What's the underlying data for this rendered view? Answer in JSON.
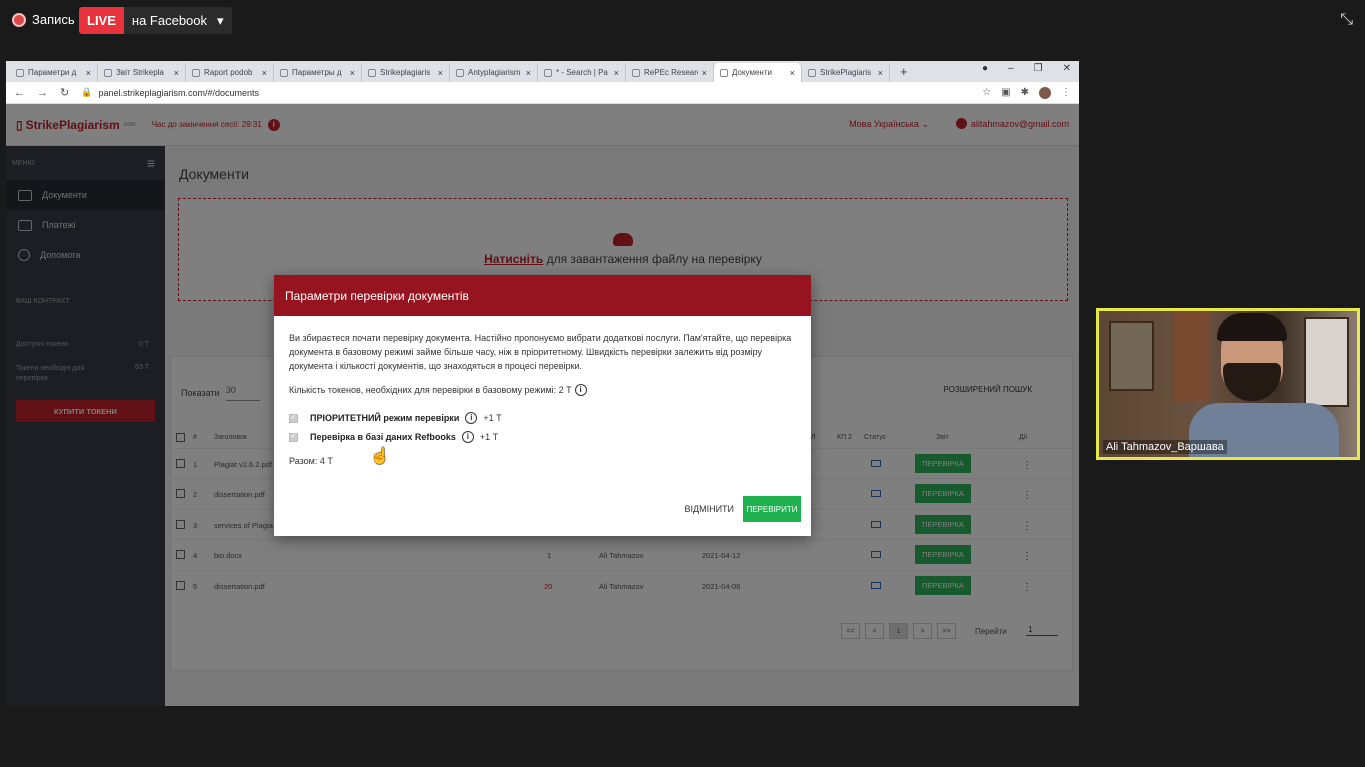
{
  "zoom": {
    "recording_label": "Запись",
    "live_label": "LIVE",
    "live_target": "на Facebook"
  },
  "browser": {
    "tabs": [
      {
        "title": "Параметри д"
      },
      {
        "title": "Звіт Strikepla"
      },
      {
        "title": "Raport podob"
      },
      {
        "title": "Параметры д"
      },
      {
        "title": "Strikeplagiaris"
      },
      {
        "title": "Antyplagiarism"
      },
      {
        "title": "* - Search | Pa"
      },
      {
        "title": "RePEc Researc"
      },
      {
        "title": "Документи",
        "active": true
      },
      {
        "title": "StrikePlagiaris"
      }
    ],
    "url": "panel.strikeplagiarism.com/#/documents"
  },
  "app": {
    "logo": "StrikePlagiarism",
    "logo_suffix": ".com",
    "session_label": "Час до закінчення сесії: 29:31",
    "language": "Мова Українська",
    "user_email": "alitahmazov@gmail.com",
    "sidebar": {
      "menu_label": "МЕНЮ",
      "items": [
        {
          "label": "Документи",
          "icon": "folder-icon"
        },
        {
          "label": "Платежі",
          "icon": "card-icon"
        },
        {
          "label": "Допомога",
          "icon": "help-icon"
        }
      ],
      "contract_label": "ВАШ КОНТРАКТ",
      "available_label": "Доступні токени",
      "available_value": "0 Т",
      "needed_label": "Токени необхідні для перевірки",
      "needed_value": "63 Т",
      "buy_label": "КУПИТИ ТОКЕНИ"
    },
    "main": {
      "title": "Документи",
      "upload_link": "Натисніть",
      "upload_rest": " для завантаження файлу на перевірку",
      "show_label": "Показати",
      "show_value": "30",
      "advanced_search": "РОЗШИРЕНИЙ ПОШУК",
      "columns": {
        "num": "#",
        "title": "Заголовок",
        "kp1": "Л",
        "kp2": "КП 2",
        "status": "Статус",
        "report": "Звіт",
        "actions": "Дії"
      },
      "rows": [
        {
          "num": "1",
          "title": "Plagiat v2.6.2.pdf",
          "kp": "",
          "author": "",
          "date": "",
          "action": "ПЕРЕВІРКА"
        },
        {
          "num": "2",
          "title": "dissertation.pdf",
          "kp": "",
          "author": "",
          "date": "",
          "action": "ПЕРЕВІРКА"
        },
        {
          "num": "3",
          "title": "services of Plagia",
          "kp": "",
          "author": "",
          "date": "",
          "action": "ПЕРЕВІРКА"
        },
        {
          "num": "4",
          "title": "bio.docx",
          "kp": "1",
          "author": "Ali Tahmazov",
          "date": "2021-04-12",
          "action": "ПЕРЕВІРКА"
        },
        {
          "num": "5",
          "title": "dissertation.pdf",
          "kp": "20",
          "author": "Ali Tahmazov",
          "date": "2021-04-06",
          "action": "ПЕРЕВІРКА"
        }
      ],
      "pager": [
        "<<",
        "<",
        "1",
        ">",
        ">>"
      ],
      "goto_label": "Перейти",
      "goto_value": "1"
    }
  },
  "modal": {
    "title": "Параметри перевірки документів",
    "intro": "Ви збираєтеся почати перевірку документа. Настійно пропонуємо вибрати додаткові послуги. Пам'ятайте, що перевірка документа в базовому режимі займе більше часу, ніж в пріоритетному. Швидкість перевірки залежить від розміру документа і кількості документів, що знаходяться в процесі перевірки.",
    "token_count": "Кількість токенов, необхідних для перевірки в базовому режимі: 2 Т",
    "options": [
      {
        "label": "ПРІОРИТЕТНИЙ режим перевірки",
        "cost": "+1 Т"
      },
      {
        "label": "Перевірка в базі даних Refbooks",
        "cost": "+1 Т"
      }
    ],
    "total": "Разом: 4 Т",
    "cancel_label": "ВІДМІНИТИ",
    "submit_label": "ПЕРЕВІРИТИ"
  },
  "video": {
    "participant_name": "Ali Tahmazov_Варшава"
  }
}
